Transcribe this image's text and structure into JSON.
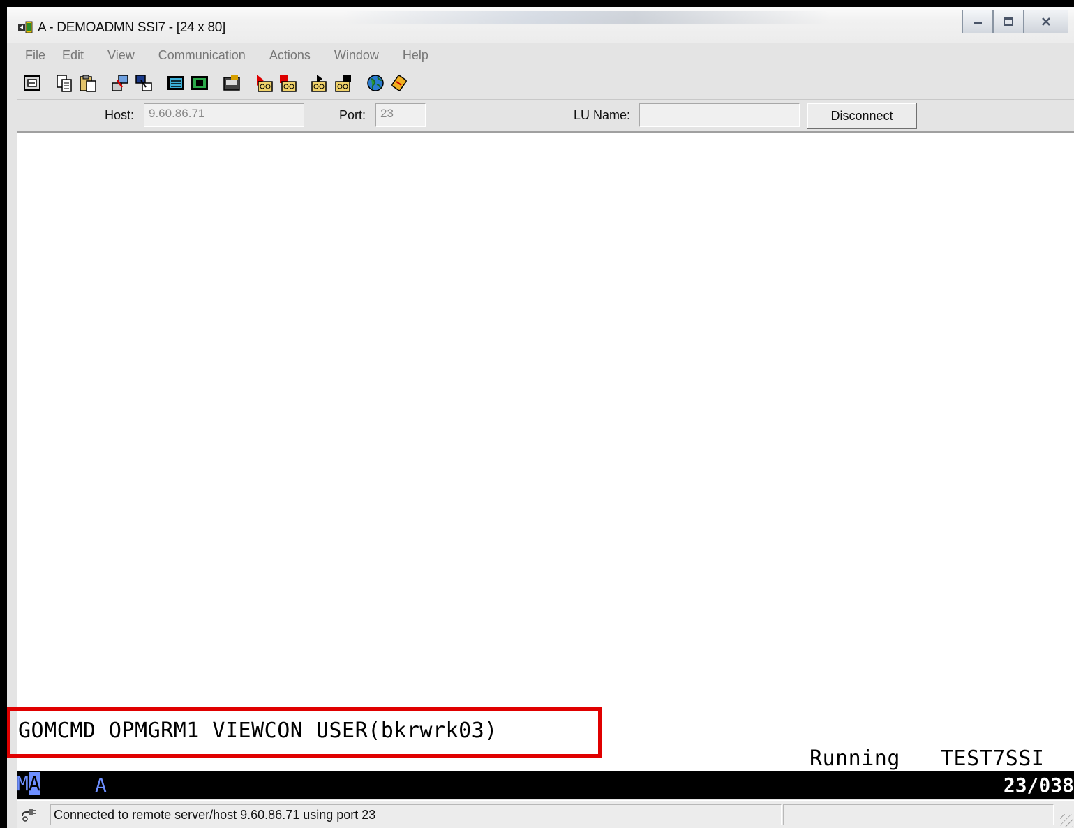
{
  "window": {
    "title": "A - DEMOADMN SSI7 - [24 x 80]",
    "controls": [
      "minimize-icon",
      "maximize-icon",
      "close-icon"
    ]
  },
  "menu": {
    "items": [
      "File",
      "Edit",
      "View",
      "Communication",
      "Actions",
      "Window",
      "Help"
    ]
  },
  "toolbar": {
    "icons": [
      "print-screen-icon",
      "copy-icon",
      "paste-icon",
      "send-file-icon",
      "receive-file-icon",
      "keyboard-map-icon",
      "color-map-icon",
      "macro-icon",
      "record-macro-icon",
      "stop-macro-icon",
      "play-macro-icon",
      "macro-settings-icon",
      "globe-icon",
      "help-icon"
    ]
  },
  "connection": {
    "host_label": "Host:",
    "host_value": "9.60.86.71",
    "port_label": "Port:",
    "port_value": "23",
    "lu_label": "LU Name:",
    "lu_value": "",
    "disconnect_label": "Disconnect"
  },
  "terminal": {
    "command_line": "GOMCMD OPMGRM1 VIEWCON USER(bkrwrk03)",
    "status_word": "Running",
    "system_name": "TEST7SSI",
    "highlight_color": "#e00000"
  },
  "oia": {
    "indicator_prefix": "M",
    "indicator_cursor": "A",
    "session_letter": "A",
    "cursor_position": "23/038"
  },
  "statusbar": {
    "message": "Connected to remote server/host 9.60.86.71 using port 23"
  }
}
